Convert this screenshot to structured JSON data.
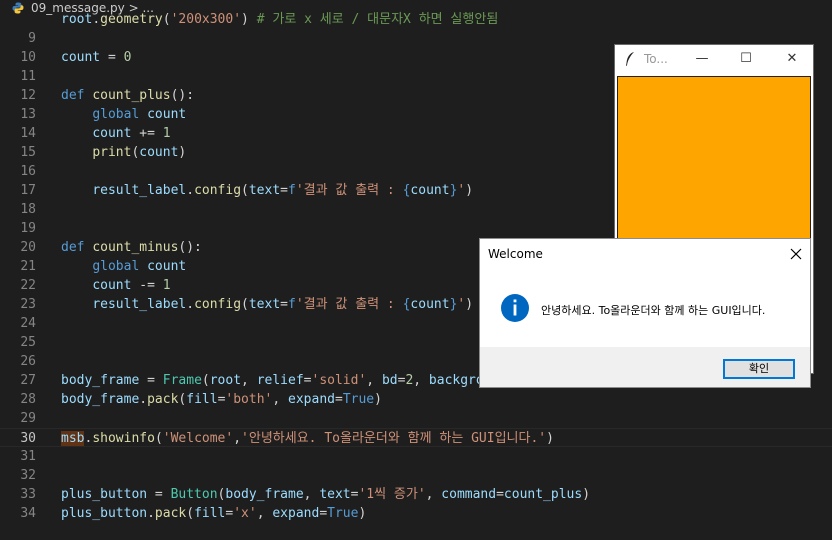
{
  "tab": {
    "filename": "09_message.py",
    "breadcrumb_sep": ">",
    "breadcrumb_more": "..."
  },
  "editor": {
    "top_partial": {
      "num": "",
      "text": "root.geometry('200x300') # 가로 x 세로 / 대문자X 하면 실행안됨"
    },
    "line_numbers": [
      "9",
      "10",
      "11",
      "12",
      "13",
      "14",
      "15",
      "16",
      "17",
      "18",
      "19",
      "20",
      "21",
      "22",
      "23",
      "24",
      "25",
      "26",
      "27",
      "28",
      "29",
      "30",
      "31",
      "32",
      "33",
      "34"
    ],
    "active_line": "30"
  },
  "tk_window": {
    "title": "To...",
    "min": "—",
    "max": "☐",
    "close": "✕"
  },
  "dialog": {
    "title": "Welcome",
    "message": "안녕하세요. To올라운더와 함께 하는 GUI입니다.",
    "ok_label": "확인",
    "accent": "#0078d7"
  },
  "colors": {
    "editor_bg": "#1e1e1e",
    "orange": "#ffa500"
  }
}
